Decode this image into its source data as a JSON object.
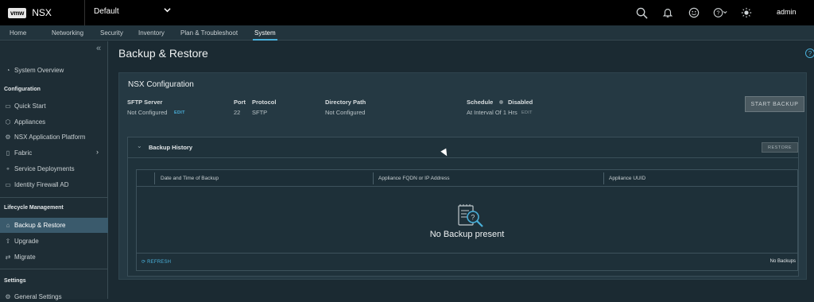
{
  "header": {
    "logo": "vmw",
    "app_name": "NSX",
    "project": "Default",
    "user": "admin",
    "icons": [
      "search-icon",
      "bell-icon",
      "smiley-icon",
      "help-icon",
      "sun-icon"
    ]
  },
  "nav": {
    "tabs": [
      "Home",
      "Networking",
      "Security",
      "Inventory",
      "Plan & Troubleshoot",
      "System"
    ],
    "active": "System"
  },
  "sidebar": {
    "overview": "System Overview",
    "config_header": "Configuration",
    "config_items": [
      "Quick Start",
      "Appliances",
      "NSX Application Platform",
      "Fabric",
      "Service Deployments",
      "Identity Firewall AD"
    ],
    "lifecycle_header": "Lifecycle Management",
    "lifecycle_items": [
      "Backup & Restore",
      "Upgrade",
      "Migrate"
    ],
    "settings_header": "Settings",
    "settings_items": [
      "General Settings"
    ]
  },
  "page": {
    "title": "Backup & Restore",
    "section_title": "NSX Configuration",
    "sftp_label": "SFTP Server",
    "sftp_value": "Not Configured",
    "edit": "EDIT",
    "port_label": "Port",
    "port_value": "22",
    "protocol_label": "Protocol",
    "protocol_value": "SFTP",
    "dir_label": "Directory Path",
    "dir_value": "Not Configured",
    "schedule_label": "Schedule",
    "schedule_status": "Disabled",
    "schedule_value": "At Interval Of 1 Hrs",
    "start_backup": "START BACKUP",
    "history_title": "Backup History",
    "restore": "RESTORE",
    "columns": [
      "Date and Time of Backup",
      "Appliance FQDN or IP Address",
      "Appliance UUID"
    ],
    "empty": "No Backup present",
    "refresh": "REFRESH",
    "count": "No Backups"
  },
  "colors": {
    "accent": "#49afd9",
    "selected": "#3a5a6c"
  }
}
